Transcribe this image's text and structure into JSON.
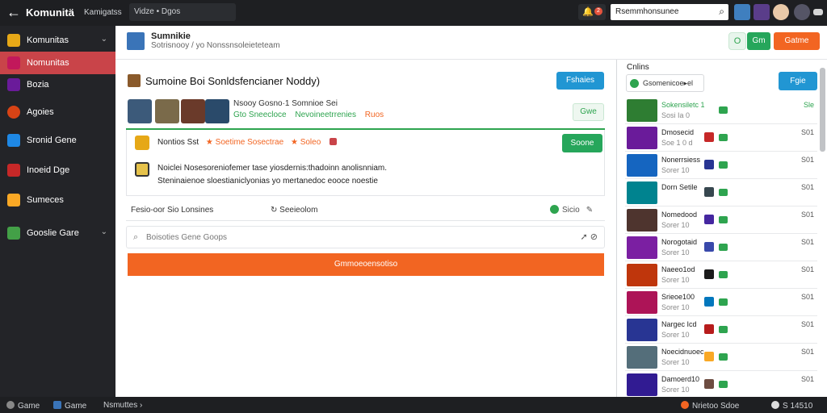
{
  "topbar": {
    "title": "Komunitä",
    "links": [
      "Kamigatss",
      "Vide"
    ],
    "crumb": "Vidze  •  Dgos",
    "notif_count": "2",
    "search_value": "Rsemmhonsunee"
  },
  "sidebar": {
    "items": [
      {
        "label": "Komunitas",
        "icon_color": "#e6a817",
        "chev": "⌄"
      },
      {
        "label": "Nomunitas",
        "icon_color": "#c2185b",
        "chev": ""
      },
      {
        "label": "Bozia",
        "icon_color": "#6a1b9a",
        "chev": ""
      },
      {
        "label": "Agoies",
        "icon_color": "#d84315",
        "chev": ""
      },
      {
        "label": "Sronid Gene",
        "icon_color": "#1e88e5",
        "chev": ""
      },
      {
        "label": "Inoeid Dge",
        "icon_color": "#c62828",
        "chev": ""
      },
      {
        "label": "Sumeces",
        "icon_color": "#f9a825",
        "chev": ""
      },
      {
        "label": "Gooslie Gare",
        "icon_color": "#43a047",
        "chev": "⌄"
      }
    ]
  },
  "header": {
    "name": "Sumnikie",
    "subtitle": "Sotrisnooy / yo Nonssnsoleieteteam",
    "circle_label": "O",
    "green_label": "Gm",
    "orange_label": "Gatme"
  },
  "post": {
    "title": "Sumoine Boi Sonldsfencianer Noddy)",
    "blue_button": "Fshaies",
    "meta_line1": "Nsooy Gosno·1  Somnioe  Sei",
    "meta_line2_a": "Gto  Sneecloce",
    "meta_line2_b": "Nevoineetrrenies",
    "meta_line2_c": "Ruos",
    "light_button": "Gwe",
    "card_author": "Nontios  Sst",
    "card_meta_a": "Soetime  Sosectrae",
    "card_meta_b": "Soleo",
    "card_button": "Soone",
    "card_line1": "Noiclei Nosesoreniofemer tase yiosdernis:thadoinn anolisnniam.",
    "card_line2": "Steninaienoe sloestianiclyonias yo mertanedoc eooce  noestie",
    "action_left": "Fesio-oor Sio Lonsines",
    "action_mid": "Seeieolom",
    "action_right": "Sicio",
    "comment_placeholder": "Boisoties Gene Goops",
    "orange_bar": "Gmmoeoensotiso"
  },
  "right_panel": {
    "title": "Cnlins",
    "select_value": "Gsomenicoe▸el",
    "blue_button": "Fgie",
    "rows": [
      {
        "name": "Sokensiletc 1",
        "sub": "Sosi  Ia 0",
        "num": "Sle",
        "thumb": "#2e7d32",
        "i1": "",
        "highlight": true
      },
      {
        "name": "Dmosecid",
        "sub": "Soe 1 0 d",
        "num": "S01",
        "thumb": "#6a1b9a",
        "i1": "#c62828"
      },
      {
        "name": "Nonerrsiess",
        "sub": "Sorer 10",
        "num": "S01",
        "thumb": "#1565c0",
        "i1": "#283593"
      },
      {
        "name": "Dorn Setile",
        "sub": "",
        "num": "S01",
        "thumb": "#00838f",
        "i1": "#37474f"
      },
      {
        "name": "Nomedood",
        "sub": "Sorer 10",
        "num": "S01",
        "thumb": "#4e342e",
        "i1": "#4527a0"
      },
      {
        "name": "Norogotaid",
        "sub": "Sorer 10",
        "num": "S01",
        "thumb": "#7b1fa2",
        "i1": "#3949ab"
      },
      {
        "name": "Naeeo1od",
        "sub": "Sorer 10",
        "num": "S01",
        "thumb": "#bf360c",
        "i1": "#1b1b1b"
      },
      {
        "name": "Srieoe100",
        "sub": "Sorer 10",
        "num": "S01",
        "thumb": "#ad1457",
        "i1": "#0277bd"
      },
      {
        "name": "Nargec Icd",
        "sub": "Sorer 10",
        "num": "S01",
        "thumb": "#283593",
        "i1": "#b71c1c"
      },
      {
        "name": "Noecidnuoec",
        "sub": "Sorer 10",
        "num": "S01",
        "thumb": "#546e7a",
        "i1": "#f9a825"
      },
      {
        "name": "Damoerd10",
        "sub": "Sorer 10",
        "num": "S01",
        "thumb": "#311b92",
        "i1": "#6d4c41"
      }
    ]
  },
  "bottombar": {
    "left_a": "Game",
    "left_b": "Game",
    "left_c": "Nsmuttes ›",
    "right_a": "Nrietoo  Sdoe",
    "right_b": "S 14510"
  }
}
